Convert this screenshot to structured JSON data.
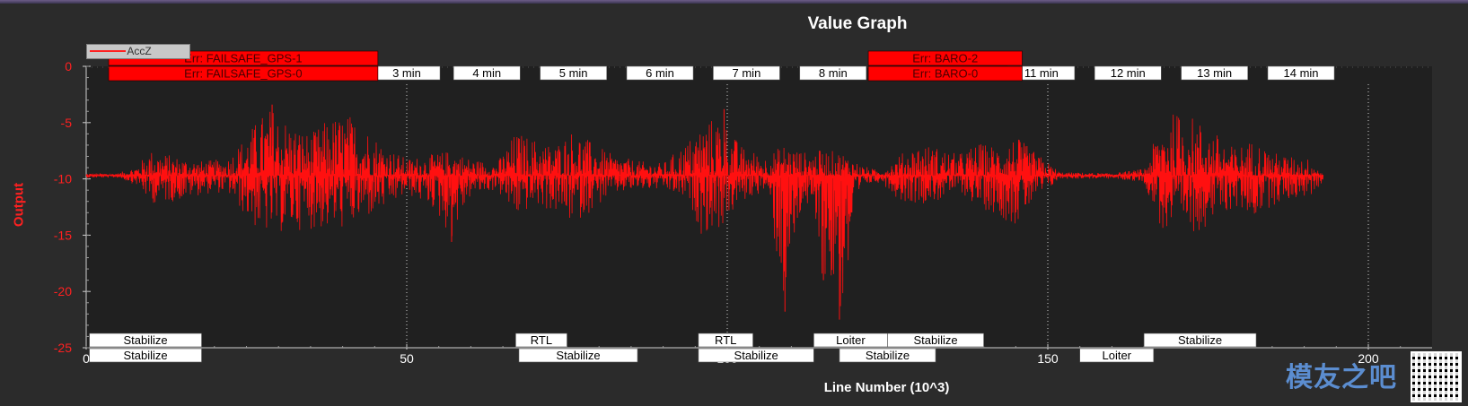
{
  "title": "Value Graph",
  "colors": {
    "background": "#2b2b2b",
    "plot": "#202020",
    "series": "#ff1010",
    "event_fill": "#ff0000",
    "label_fill": "#ffffff"
  },
  "legend": {
    "entries": [
      {
        "name": "AccZ",
        "color": "#ff1010"
      }
    ],
    "placement": "top-left"
  },
  "watermark": {
    "logo_text": "模友之吧",
    "qr_icon": "qr-code-icon"
  },
  "chart_data": {
    "type": "line",
    "title": "Value Graph",
    "xlabel": "Line Number (10^3)",
    "ylabel": "Output",
    "xlim": [
      0,
      207
    ],
    "ylim": [
      -25,
      0
    ],
    "grid": "vertical dotted at time labels",
    "x_ticks": [
      0,
      50,
      100,
      150,
      200
    ],
    "x_tick_labels": [
      "0",
      "50",
      "100",
      "150",
      "200"
    ],
    "y_ticks": [
      0,
      -5,
      -10,
      -15,
      -20,
      -25
    ],
    "y_tick_labels": [
      "0",
      "-5",
      "-10",
      "-15",
      "-20",
      "-25"
    ],
    "series": [
      {
        "name": "AccZ",
        "envelope": [
          {
            "x": 0,
            "min": -9.9,
            "max": -9.5
          },
          {
            "x": 5,
            "min": -9.9,
            "max": -9.5
          },
          {
            "x": 8,
            "min": -10.6,
            "max": -8.8
          },
          {
            "x": 10,
            "min": -12.2,
            "max": -7.4
          },
          {
            "x": 14,
            "min": -12.0,
            "max": -8.0
          },
          {
            "x": 18,
            "min": -11.4,
            "max": -8.4
          },
          {
            "x": 22,
            "min": -11.2,
            "max": -8.2
          },
          {
            "x": 25,
            "min": -13.5,
            "max": -6.0
          },
          {
            "x": 27,
            "min": -14.8,
            "max": -4.5
          },
          {
            "x": 29,
            "min": -15.0,
            "max": -3.5
          },
          {
            "x": 32,
            "min": -14.6,
            "max": -5.0
          },
          {
            "x": 35,
            "min": -14.5,
            "max": -6.0
          },
          {
            "x": 38,
            "min": -14.6,
            "max": -4.5
          },
          {
            "x": 41,
            "min": -14.4,
            "max": -4.2
          },
          {
            "x": 44,
            "min": -13.5,
            "max": -5.5
          },
          {
            "x": 47,
            "min": -12.6,
            "max": -7.2
          },
          {
            "x": 50,
            "min": -11.4,
            "max": -8.2
          },
          {
            "x": 54,
            "min": -12.6,
            "max": -7.8
          },
          {
            "x": 57,
            "min": -15.4,
            "max": -7.4
          },
          {
            "x": 60,
            "min": -11.5,
            "max": -8.2
          },
          {
            "x": 64,
            "min": -11.0,
            "max": -8.6
          },
          {
            "x": 67,
            "min": -13.5,
            "max": -5.8
          },
          {
            "x": 70,
            "min": -12.4,
            "max": -6.4
          },
          {
            "x": 73,
            "min": -13.0,
            "max": -7.0
          },
          {
            "x": 76,
            "min": -14.0,
            "max": -5.5
          },
          {
            "x": 79,
            "min": -12.8,
            "max": -6.8
          },
          {
            "x": 82,
            "min": -11.4,
            "max": -7.8
          },
          {
            "x": 86,
            "min": -11.0,
            "max": -8.4
          },
          {
            "x": 90,
            "min": -11.0,
            "max": -8.6
          },
          {
            "x": 94,
            "min": -12.0,
            "max": -6.5
          },
          {
            "x": 96,
            "min": -15.0,
            "max": -5.0
          },
          {
            "x": 99,
            "min": -14.5,
            "max": -4.2
          },
          {
            "x": 102,
            "min": -12.2,
            "max": -7.0
          },
          {
            "x": 106,
            "min": -11.0,
            "max": -8.0
          },
          {
            "x": 109,
            "min": -21.8,
            "max": -6.8
          },
          {
            "x": 112,
            "min": -11.5,
            "max": -7.6
          },
          {
            "x": 115,
            "min": -19.0,
            "max": -7.4
          },
          {
            "x": 118,
            "min": -22.5,
            "max": -7.6
          },
          {
            "x": 121,
            "min": -10.6,
            "max": -8.8
          },
          {
            "x": 124,
            "min": -10.3,
            "max": -9.3
          },
          {
            "x": 127,
            "min": -12.0,
            "max": -7.8
          },
          {
            "x": 130,
            "min": -12.2,
            "max": -6.8
          },
          {
            "x": 133,
            "min": -12.0,
            "max": -7.2
          },
          {
            "x": 136,
            "min": -11.0,
            "max": -7.8
          },
          {
            "x": 139,
            "min": -12.5,
            "max": -6.8
          },
          {
            "x": 142,
            "min": -13.2,
            "max": -7.0
          },
          {
            "x": 145,
            "min": -14.2,
            "max": -6.2
          },
          {
            "x": 148,
            "min": -12.0,
            "max": -7.6
          },
          {
            "x": 152,
            "min": -10.0,
            "max": -9.4
          },
          {
            "x": 160,
            "min": -10.0,
            "max": -9.5
          },
          {
            "x": 165,
            "min": -10.3,
            "max": -9.1
          },
          {
            "x": 168,
            "min": -15.0,
            "max": -4.5
          },
          {
            "x": 170,
            "min": -15.2,
            "max": -4.0
          },
          {
            "x": 173,
            "min": -14.8,
            "max": -4.5
          },
          {
            "x": 176,
            "min": -13.8,
            "max": -5.8
          },
          {
            "x": 179,
            "min": -12.6,
            "max": -7.2
          },
          {
            "x": 182,
            "min": -13.5,
            "max": -6.5
          },
          {
            "x": 185,
            "min": -12.4,
            "max": -7.6
          },
          {
            "x": 188,
            "min": -11.8,
            "max": -8.0
          },
          {
            "x": 191,
            "min": -11.6,
            "max": -8.2
          },
          {
            "x": 193,
            "min": -10.2,
            "max": -9.5
          }
        ],
        "spikes": [
          {
            "x": 109,
            "y": -21.8
          },
          {
            "x": 117.5,
            "y": -22.5
          },
          {
            "x": 115,
            "y": -19.0
          },
          {
            "x": 29,
            "y": -3.4
          },
          {
            "x": 99.5,
            "y": -3.8
          },
          {
            "x": 57,
            "y": -15.6
          }
        ]
      }
    ],
    "time_labels": [
      {
        "label": "3 min",
        "x": 50
      },
      {
        "label": "4 min",
        "x": 62.5
      },
      {
        "label": "5 min",
        "x": 76
      },
      {
        "label": "6 min",
        "x": 89.5
      },
      {
        "label": "7 min",
        "x": 103
      },
      {
        "label": "8 min",
        "x": 116.5
      },
      {
        "label": "11 min",
        "x": 149
      },
      {
        "label": "12 min",
        "x": 162.5
      },
      {
        "label": "13 min",
        "x": 176
      },
      {
        "label": "14 min",
        "x": 189.5
      }
    ],
    "error_events": [
      {
        "label": "Err: FAILSAFE_GPS-1",
        "x_start": 3.5,
        "x_end": 45.5,
        "row": 0
      },
      {
        "label": "Err: FAILSAFE_GPS-0",
        "x_start": 3.5,
        "x_end": 45.5,
        "row": 1
      },
      {
        "label": "Err: BARO-2",
        "x_start": 122,
        "x_end": 146,
        "row": 0
      },
      {
        "label": "Err: BARO-0",
        "x_start": 122,
        "x_end": 146,
        "row": 1
      }
    ],
    "mode_labels": [
      {
        "label": "Stabilize",
        "x_start": 0.5,
        "x_end": 18,
        "row": 0
      },
      {
        "label": "Stabilize",
        "x_start": 0.5,
        "x_end": 18,
        "row": 1
      },
      {
        "label": "RTL",
        "x_start": 67,
        "x_end": 75,
        "row": 0
      },
      {
        "label": "Stabilize",
        "x_start": 67.5,
        "x_end": 86,
        "row": 1
      },
      {
        "label": "RTL",
        "x_start": 95.5,
        "x_end": 104,
        "row": 0
      },
      {
        "label": "Stabilize",
        "x_start": 95.5,
        "x_end": 113.5,
        "row": 1
      },
      {
        "label": "Loiter",
        "x_start": 113.5,
        "x_end": 125,
        "row": 0
      },
      {
        "label": "Stabilize",
        "x_start": 125,
        "x_end": 140,
        "row": 0
      },
      {
        "label": "Stabilize",
        "x_start": 117.5,
        "x_end": 132.5,
        "row": 1
      },
      {
        "label": "Loiter",
        "x_start": 155,
        "x_end": 166.5,
        "row": 1
      },
      {
        "label": "Stabilize",
        "x_start": 165,
        "x_end": 182.5,
        "row": 0
      }
    ]
  }
}
